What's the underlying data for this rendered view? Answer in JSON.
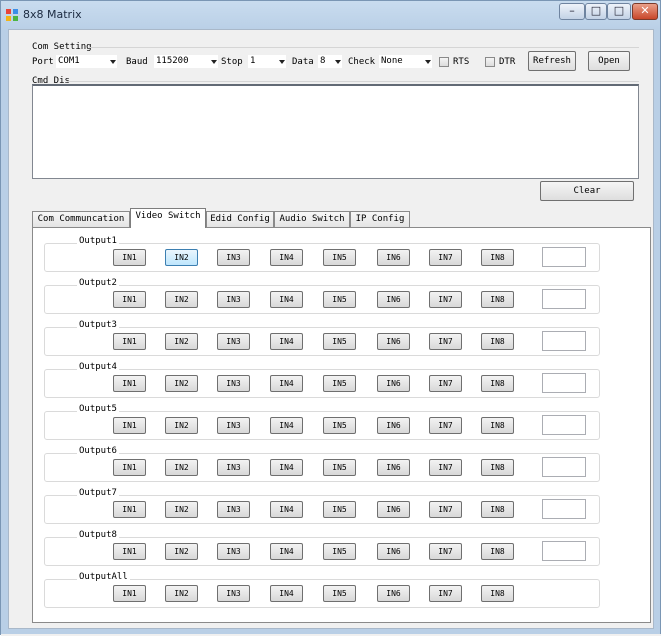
{
  "window": {
    "title": "8x8 Matrix"
  },
  "com_setting": {
    "group_label": "Com Setting",
    "port_label": "Port",
    "port_value": "COM1",
    "baud_label": "Baud",
    "baud_value": "115200",
    "stop_label": "Stop",
    "stop_value": "1",
    "data_label": "Data",
    "data_value": "8",
    "check_label": "Check",
    "check_value": "None",
    "rts_label": "RTS",
    "dtr_label": "DTR",
    "refresh_label": "Refresh",
    "open_label": "Open"
  },
  "cmd_dis": {
    "label": "Cmd Dis",
    "text": "",
    "clear_label": "Clear"
  },
  "tabs": [
    {
      "label": "Com Communcation"
    },
    {
      "label": "Video Switch"
    },
    {
      "label": "Edid Config"
    },
    {
      "label": "Audio Switch"
    },
    {
      "label": "IP Config"
    }
  ],
  "active_tab": "Video Switch",
  "video_switch": {
    "inputs": [
      "IN1",
      "IN2",
      "IN3",
      "IN4",
      "IN5",
      "IN6",
      "IN7",
      "IN8"
    ],
    "outputs": [
      {
        "label": "Output1",
        "value": "",
        "selected_input": "IN2"
      },
      {
        "label": "Output2",
        "value": ""
      },
      {
        "label": "Output3",
        "value": ""
      },
      {
        "label": "Output4",
        "value": ""
      },
      {
        "label": "Output5",
        "value": ""
      },
      {
        "label": "Output6",
        "value": ""
      },
      {
        "label": "Output7",
        "value": ""
      },
      {
        "label": "Output8",
        "value": ""
      },
      {
        "label": "OutputAll"
      }
    ]
  }
}
